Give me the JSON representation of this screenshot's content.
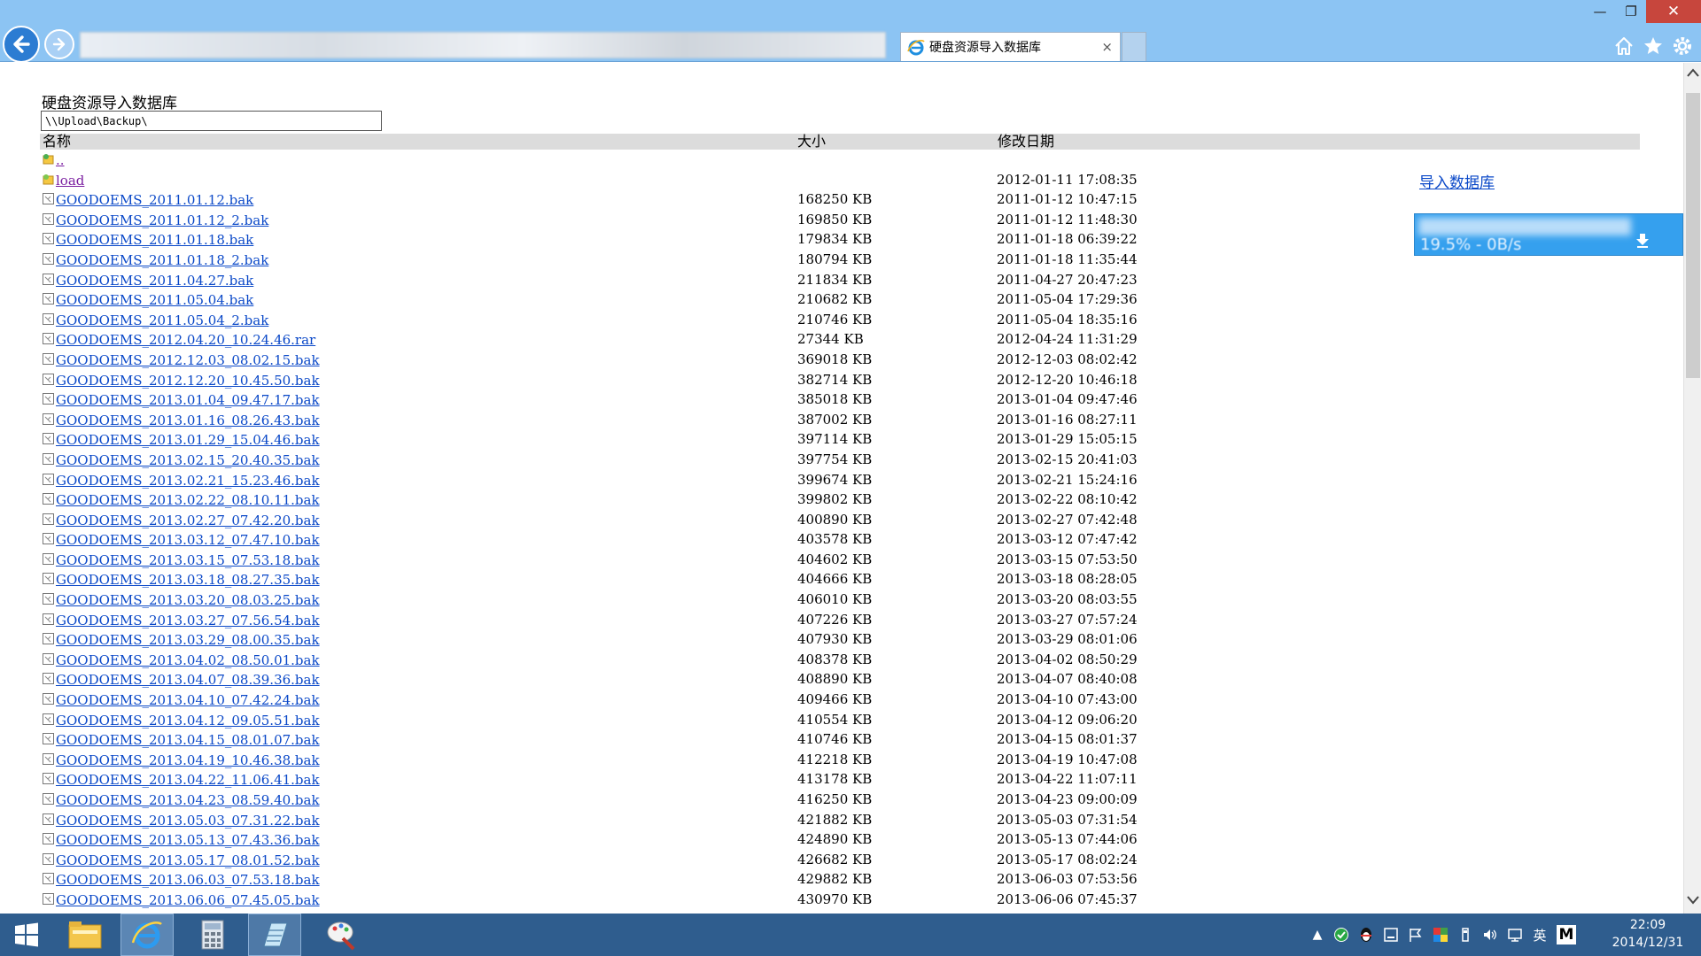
{
  "browser": {
    "tab_title": "硬盘资源导入数据库",
    "tab_close": "×",
    "window_controls": {
      "minimize": "—",
      "maximize": "❐",
      "close": "✕"
    }
  },
  "page": {
    "title": "硬盘资源导入数据库",
    "path": "\\\\Upload\\Backup\\",
    "columns": {
      "name": "名称",
      "size": "大小",
      "date": "修改日期"
    },
    "import_link": "导入数据库"
  },
  "entries": [
    {
      "name": "..",
      "size": "",
      "date": "",
      "kind": "parent"
    },
    {
      "name": "load",
      "size": "",
      "date": "2012-01-11 17:08:35",
      "kind": "folder"
    },
    {
      "name": "GOODOEMS_2011.01.12.bak",
      "size": "168250 KB",
      "date": "2011-01-12 10:47:15",
      "kind": "file"
    },
    {
      "name": "GOODOEMS_2011.01.12_2.bak",
      "size": "169850 KB",
      "date": "2011-01-12 11:48:30",
      "kind": "file"
    },
    {
      "name": "GOODOEMS_2011.01.18.bak",
      "size": "179834 KB",
      "date": "2011-01-18 06:39:22",
      "kind": "file"
    },
    {
      "name": "GOODOEMS_2011.01.18_2.bak",
      "size": "180794 KB",
      "date": "2011-01-18 11:35:44",
      "kind": "file"
    },
    {
      "name": "GOODOEMS_2011.04.27.bak",
      "size": "211834 KB",
      "date": "2011-04-27 20:47:23",
      "kind": "file"
    },
    {
      "name": "GOODOEMS_2011.05.04.bak",
      "size": "210682 KB",
      "date": "2011-05-04 17:29:36",
      "kind": "file"
    },
    {
      "name": "GOODOEMS_2011.05.04_2.bak",
      "size": "210746 KB",
      "date": "2011-05-04 18:35:16",
      "kind": "file"
    },
    {
      "name": "GOODOEMS_2012.04.20_10.24.46.rar",
      "size": "27344 KB",
      "date": "2012-04-24 11:31:29",
      "kind": "file"
    },
    {
      "name": "GOODOEMS_2012.12.03_08.02.15.bak",
      "size": "369018 KB",
      "date": "2012-12-03 08:02:42",
      "kind": "file"
    },
    {
      "name": "GOODOEMS_2012.12.20_10.45.50.bak",
      "size": "382714 KB",
      "date": "2012-12-20 10:46:18",
      "kind": "file"
    },
    {
      "name": "GOODOEMS_2013.01.04_09.47.17.bak",
      "size": "385018 KB",
      "date": "2013-01-04 09:47:46",
      "kind": "file"
    },
    {
      "name": "GOODOEMS_2013.01.16_08.26.43.bak",
      "size": "387002 KB",
      "date": "2013-01-16 08:27:11",
      "kind": "file"
    },
    {
      "name": "GOODOEMS_2013.01.29_15.04.46.bak",
      "size": "397114 KB",
      "date": "2013-01-29 15:05:15",
      "kind": "file"
    },
    {
      "name": "GOODOEMS_2013.02.15_20.40.35.bak",
      "size": "397754 KB",
      "date": "2013-02-15 20:41:03",
      "kind": "file"
    },
    {
      "name": "GOODOEMS_2013.02.21_15.23.46.bak",
      "size": "399674 KB",
      "date": "2013-02-21 15:24:16",
      "kind": "file"
    },
    {
      "name": "GOODOEMS_2013.02.22_08.10.11.bak",
      "size": "399802 KB",
      "date": "2013-02-22 08:10:42",
      "kind": "file"
    },
    {
      "name": "GOODOEMS_2013.02.27_07.42.20.bak",
      "size": "400890 KB",
      "date": "2013-02-27 07:42:48",
      "kind": "file"
    },
    {
      "name": "GOODOEMS_2013.03.12_07.47.10.bak",
      "size": "403578 KB",
      "date": "2013-03-12 07:47:42",
      "kind": "file"
    },
    {
      "name": "GOODOEMS_2013.03.15_07.53.18.bak",
      "size": "404602 KB",
      "date": "2013-03-15 07:53:50",
      "kind": "file"
    },
    {
      "name": "GOODOEMS_2013.03.18_08.27.35.bak",
      "size": "404666 KB",
      "date": "2013-03-18 08:28:05",
      "kind": "file"
    },
    {
      "name": "GOODOEMS_2013.03.20_08.03.25.bak",
      "size": "406010 KB",
      "date": "2013-03-20 08:03:55",
      "kind": "file"
    },
    {
      "name": "GOODOEMS_2013.03.27_07.56.54.bak",
      "size": "407226 KB",
      "date": "2013-03-27 07:57:24",
      "kind": "file"
    },
    {
      "name": "GOODOEMS_2013.03.29_08.00.35.bak",
      "size": "407930 KB",
      "date": "2013-03-29 08:01:06",
      "kind": "file"
    },
    {
      "name": "GOODOEMS_2013.04.02_08.50.01.bak",
      "size": "408378 KB",
      "date": "2013-04-02 08:50:29",
      "kind": "file"
    },
    {
      "name": "GOODOEMS_2013.04.07_08.39.36.bak",
      "size": "408890 KB",
      "date": "2013-04-07 08:40:08",
      "kind": "file"
    },
    {
      "name": "GOODOEMS_2013.04.10_07.42.24.bak",
      "size": "409466 KB",
      "date": "2013-04-10 07:43:00",
      "kind": "file"
    },
    {
      "name": "GOODOEMS_2013.04.12_09.05.51.bak",
      "size": "410554 KB",
      "date": "2013-04-12 09:06:20",
      "kind": "file"
    },
    {
      "name": "GOODOEMS_2013.04.15_08.01.07.bak",
      "size": "410746 KB",
      "date": "2013-04-15 08:01:37",
      "kind": "file"
    },
    {
      "name": "GOODOEMS_2013.04.19_10.46.38.bak",
      "size": "412218 KB",
      "date": "2013-04-19 10:47:08",
      "kind": "file"
    },
    {
      "name": "GOODOEMS_2013.04.22_11.06.41.bak",
      "size": "413178 KB",
      "date": "2013-04-22 11:07:11",
      "kind": "file"
    },
    {
      "name": "GOODOEMS_2013.04.23_08.59.40.bak",
      "size": "416250 KB",
      "date": "2013-04-23 09:00:09",
      "kind": "file"
    },
    {
      "name": "GOODOEMS_2013.05.03_07.31.22.bak",
      "size": "421882 KB",
      "date": "2013-05-03 07:31:54",
      "kind": "file"
    },
    {
      "name": "GOODOEMS_2013.05.13_07.43.36.bak",
      "size": "424890 KB",
      "date": "2013-05-13 07:44:06",
      "kind": "file"
    },
    {
      "name": "GOODOEMS_2013.05.17_08.01.52.bak",
      "size": "426682 KB",
      "date": "2013-05-17 08:02:24",
      "kind": "file"
    },
    {
      "name": "GOODOEMS_2013.06.03_07.53.18.bak",
      "size": "429882 KB",
      "date": "2013-06-03 07:53:56",
      "kind": "file"
    },
    {
      "name": "GOODOEMS_2013.06.06_07.45.05.bak",
      "size": "430970 KB",
      "date": "2013-06-06 07:45:37",
      "kind": "file"
    }
  ],
  "download_widget": {
    "speed_text": "19.5% - 0B/s"
  },
  "taskbar": {
    "items": [
      "start-icon",
      "file-explorer-icon",
      "internet-explorer-icon",
      "calculator-icon",
      "notepad-icon",
      "paint-icon"
    ],
    "ime_label": "英",
    "ime_mode": "M",
    "time": "22:09",
    "date": "2014/12/31"
  },
  "colors": {
    "titlebar": "#8cc4f3",
    "taskbar": "#2f5d8e",
    "link": "#0a48c8",
    "visited": "#7a1da0",
    "header_row": "#dcdcdc",
    "close_button": "#c7463d"
  }
}
